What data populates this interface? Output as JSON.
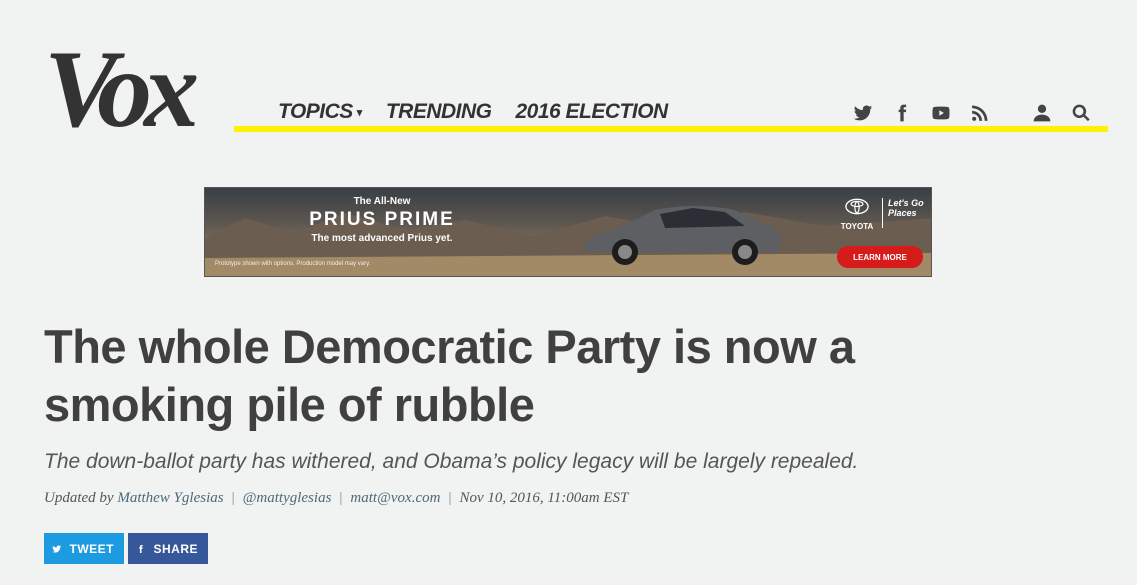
{
  "brand": {
    "logo_text": "Vox"
  },
  "nav": {
    "links": [
      {
        "label": "TOPICS",
        "has_caret": true
      },
      {
        "label": "TRENDING"
      },
      {
        "label": "2016 ELECTION"
      }
    ],
    "icons": [
      "twitter-icon",
      "facebook-icon",
      "youtube-icon",
      "rss-icon",
      "user-icon",
      "search-icon"
    ],
    "accent_color": "#fff200"
  },
  "ad": {
    "eyebrow": "The All-New",
    "brand": "PRIUS PRIME",
    "sub": "The most advanced Prius yet.",
    "fine_print": "Prototype shown with options. Production model may vary.",
    "advertiser": "TOYOTA",
    "slogan": "Let's Go Places",
    "cta": "LEARN MORE"
  },
  "article": {
    "headline": "The whole Democratic Party is now a smoking pile of rubble",
    "dek": "The down-ballot party has withered, and Obama’s policy legacy will be largely repealed.",
    "byline": {
      "prefix": "Updated by",
      "author": "Matthew Yglesias",
      "twitter": "@mattyglesias",
      "email": "matt@vox.com",
      "date": "Nov 10, 2016, 11:00am EST"
    },
    "share": {
      "tweet_label": "TWEET",
      "share_label": "SHARE",
      "tweet_color": "#1d9be0",
      "facebook_color": "#36589a"
    }
  }
}
